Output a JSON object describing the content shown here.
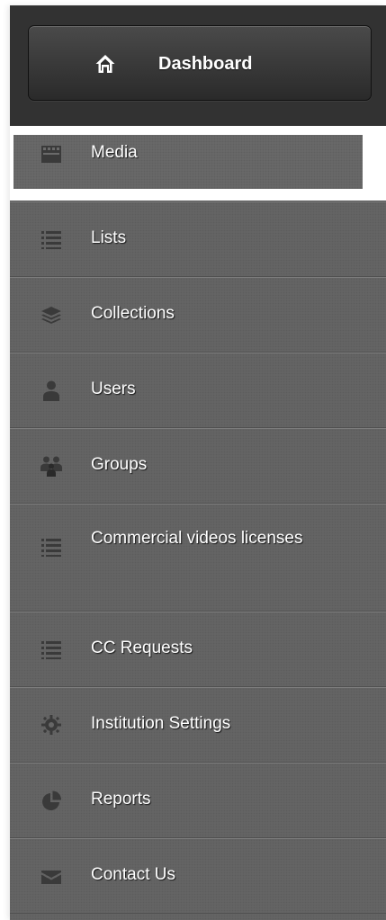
{
  "dashboard": {
    "label": "Dashboard",
    "icon": "home-icon"
  },
  "nav": {
    "active_item": "Media",
    "items": [
      {
        "label": "Media",
        "icon": "film-icon"
      },
      {
        "label": "Lists",
        "icon": "list-icon"
      },
      {
        "label": "Collections",
        "icon": "layers-icon"
      },
      {
        "label": "Users",
        "icon": "user-icon"
      },
      {
        "label": "Groups",
        "icon": "group-icon"
      },
      {
        "label": "Commercial videos licenses",
        "icon": "list-icon"
      },
      {
        "label": "CC Requests",
        "icon": "list-icon"
      },
      {
        "label": "Institution Settings",
        "icon": "gear-icon"
      },
      {
        "label": "Reports",
        "icon": "pie-chart-icon"
      },
      {
        "label": "Contact Us",
        "icon": "envelope-icon"
      }
    ]
  },
  "colors": {
    "sidebar_bg": "#666666",
    "header_bg": "#323232",
    "icon": "#3a3a3a",
    "text": "#ffffff",
    "active_border": "#ffffff"
  }
}
